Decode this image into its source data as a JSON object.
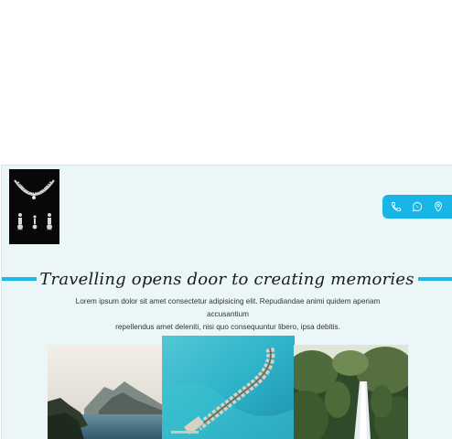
{
  "headline": "Travelling opens door to creating memories",
  "subtext": {
    "line1": "Lorem ipsum dolor sit amet consectetur adipisicing elit. Repudiandae animi quidem aperiam accusantium",
    "line2": "repellendus amet deleniti, nisi quo consequuntur libero, ipsa debitis."
  },
  "contact_bar": {
    "icons": [
      "phone-icon",
      "whatsapp-icon",
      "location-pin-icon"
    ],
    "color": "#18b6e6"
  },
  "accent_color": "#17b9ea",
  "gallery": [
    "coastal-mountain-photo",
    "overwater-villas-photo",
    "jungle-waterfall-photo"
  ]
}
